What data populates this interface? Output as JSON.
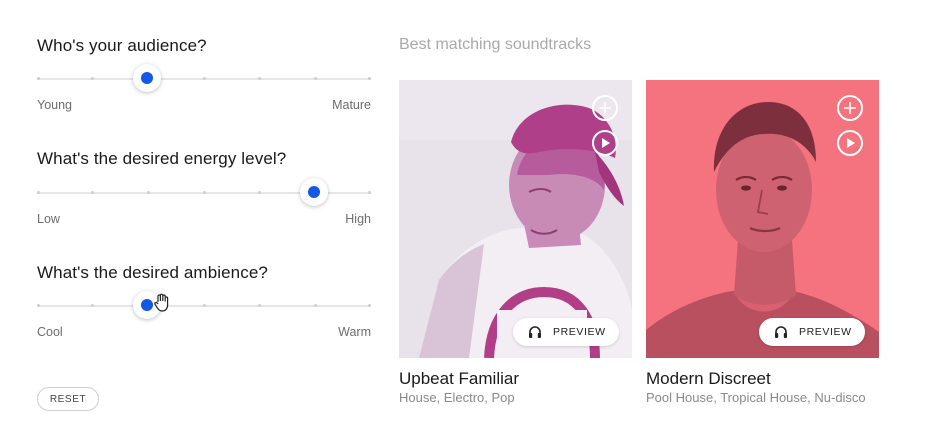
{
  "questions": [
    {
      "title": "Who's your audience?",
      "min_label": "Young",
      "max_label": "Mature",
      "value": 0.33
    },
    {
      "title": "What's the desired energy level?",
      "min_label": "Low",
      "max_label": "High",
      "value": 0.83
    },
    {
      "title": "What's the desired ambience?",
      "min_label": "Cool",
      "max_label": "Warm",
      "value": 0.33
    }
  ],
  "reset_label": "RESET",
  "results": {
    "title": "Best matching soundtracks",
    "cards": [
      {
        "title": "Upbeat Familiar",
        "tags": "House, Electro, Pop",
        "preview_label": "PREVIEW",
        "tint": "#b84c8f",
        "bg": "#e7e1ea"
      },
      {
        "title": "Modern Discreet",
        "tags": "Pool House, Tropical House, Nu-disco",
        "preview_label": "PREVIEW",
        "tint": "#c94a64",
        "bg": "#f3727f"
      }
    ]
  },
  "icons": {
    "add": "plus-circle-icon",
    "play": "play-circle-icon",
    "preview": "headphones-icon",
    "cursor": "hand-cursor-icon"
  },
  "colors": {
    "accent": "#1358e6"
  }
}
